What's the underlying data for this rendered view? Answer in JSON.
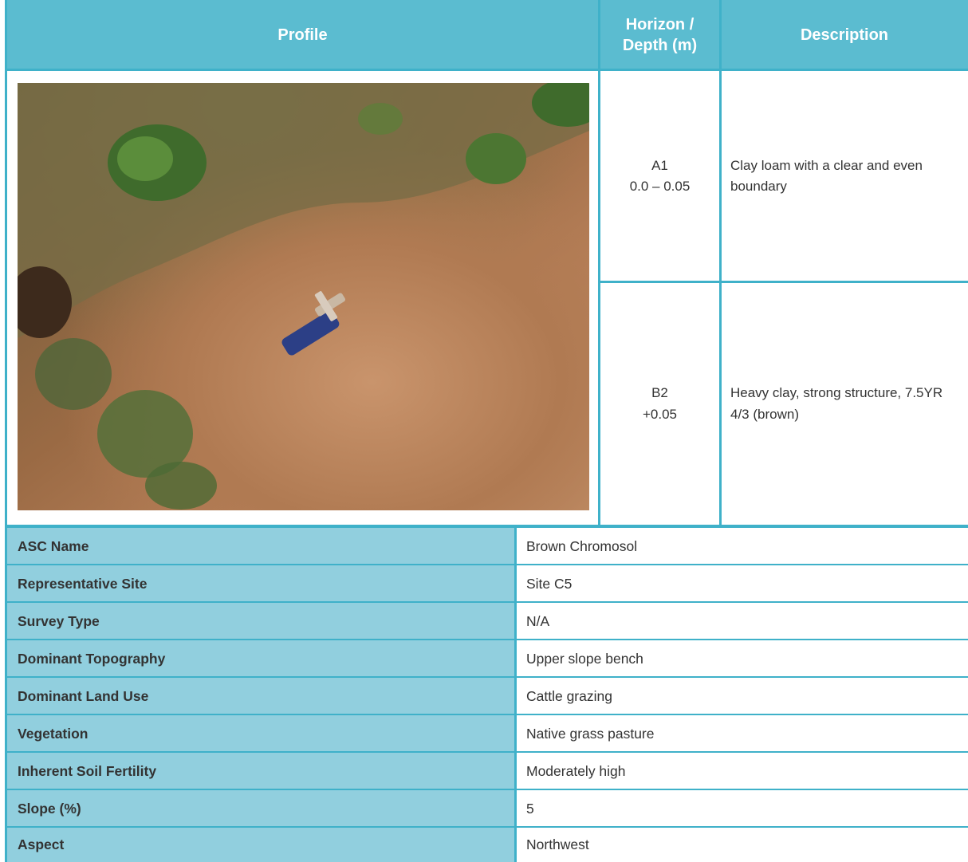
{
  "header": {
    "profile": "Profile",
    "horizon_line1": "Horizon /",
    "horizon_line2": "Depth (m)",
    "description": "Description"
  },
  "profile_photo": {
    "alt": "Soil profile photo with geological hammer"
  },
  "horizons": [
    {
      "name": "A1",
      "depth": "0.0 – 0.05",
      "description": "Clay loam with a clear and even boundary"
    },
    {
      "name": "B2",
      "depth": "+0.05",
      "description": "Heavy clay, strong structure, 7.5YR 4/3 (brown)"
    }
  ],
  "attributes": [
    {
      "label": "ASC Name",
      "value": "Brown Chromosol"
    },
    {
      "label": "Representative Site",
      "value": "Site C5"
    },
    {
      "label": "Survey Type",
      "value": "N/A"
    },
    {
      "label": "Dominant Topography",
      "value": "Upper slope bench"
    },
    {
      "label": "Dominant Land Use",
      "value": "Cattle grazing"
    },
    {
      "label": "Vegetation",
      "value": "Native grass pasture"
    },
    {
      "label": "Inherent Soil Fertility",
      "value": "Moderately high"
    },
    {
      "label": "Slope (%)",
      "value": "5"
    },
    {
      "label": "Aspect",
      "value": "Northwest"
    }
  ],
  "colors": {
    "header_bg": "#5bbcd0",
    "label_bg": "#91cfde",
    "border": "#3fb1c9"
  }
}
